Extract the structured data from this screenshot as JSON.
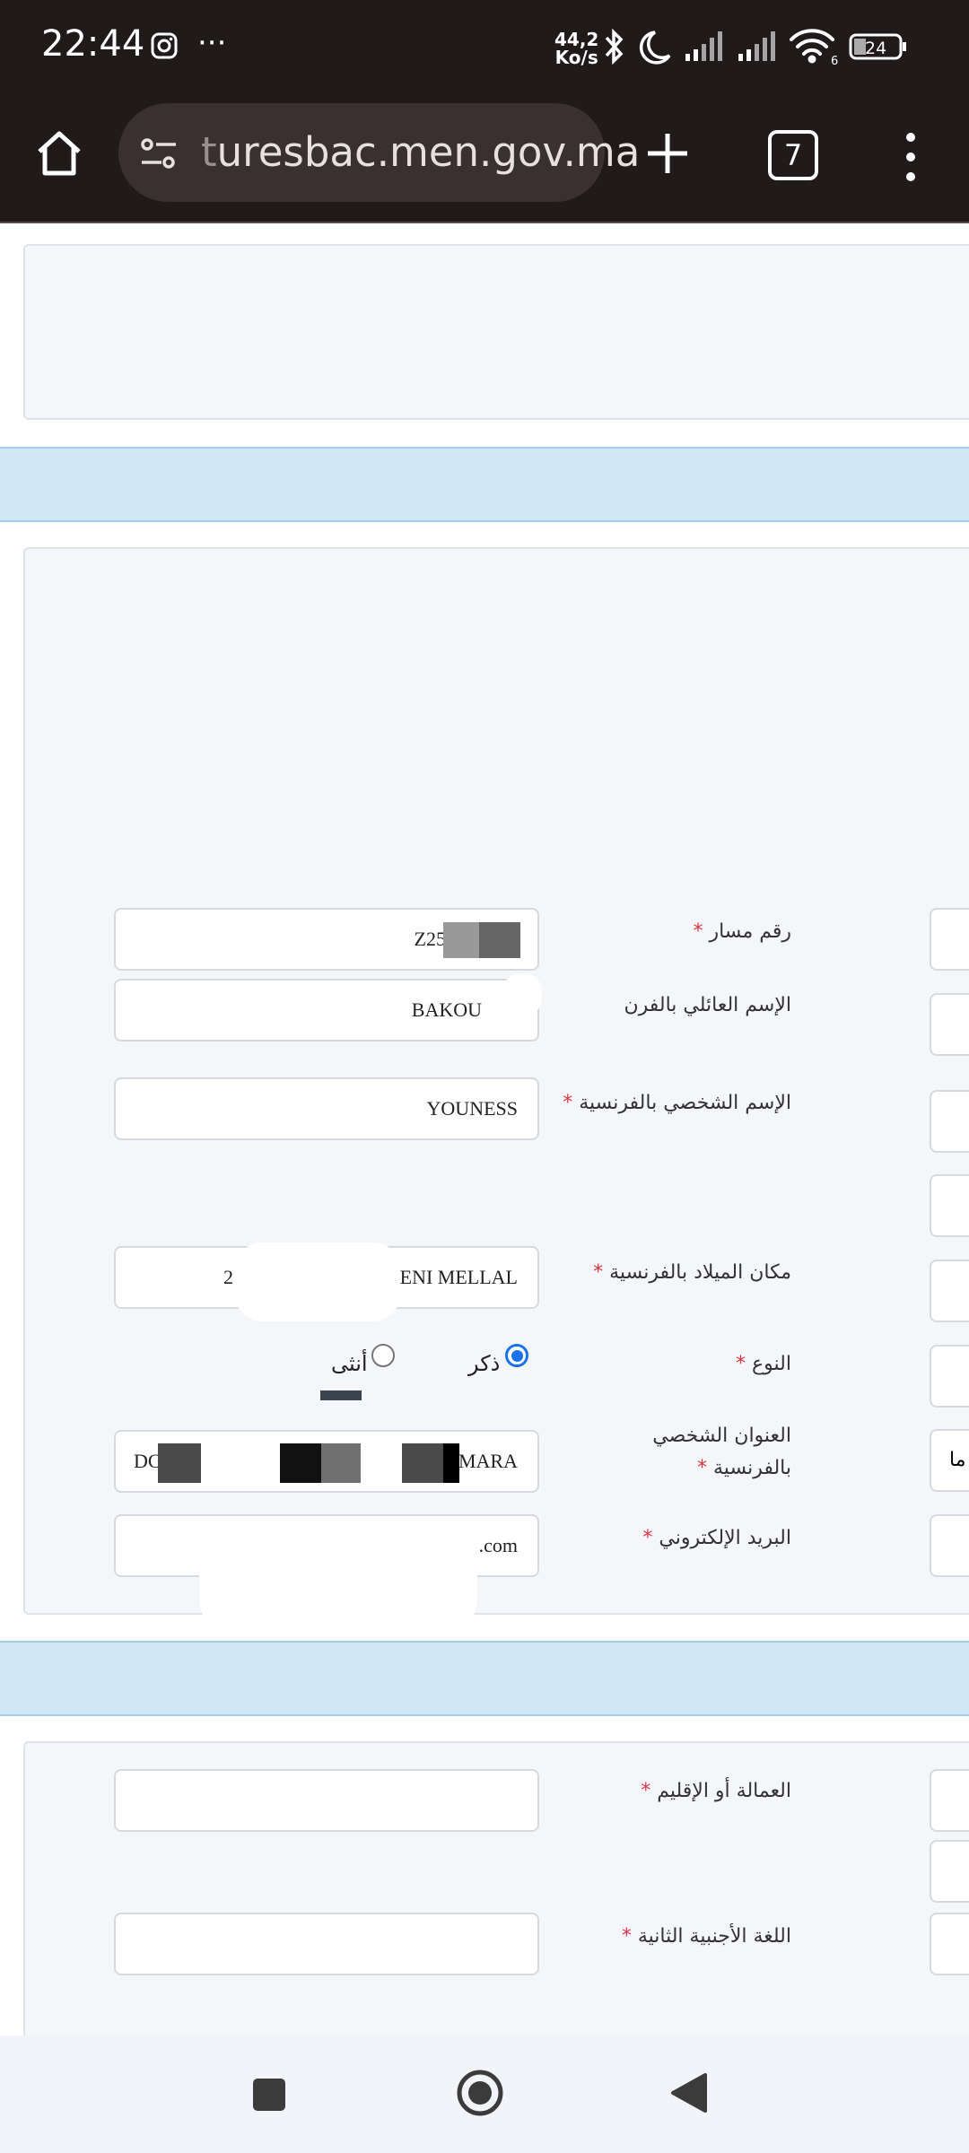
{
  "status_bar": {
    "time": "22:44",
    "more": "···",
    "net_speed_value": "44,2",
    "net_speed_unit": "Ko/s",
    "wifi_badge": "6",
    "battery": "24"
  },
  "browser": {
    "url_dim": "t",
    "url": "uresbac.men.gov.ma",
    "tab_count": "7"
  },
  "form": {
    "fields": [
      {
        "label": "رقم مسار",
        "required": true,
        "value": "Z25"
      },
      {
        "label": "الإسم العائلي بالفرن",
        "required": false,
        "value": "BAKOU"
      },
      {
        "label": "الإسم الشخصي بالفرنسية",
        "required": true,
        "value": "YOUNESS"
      },
      {
        "label": "مكان الميلاد بالفرنسية",
        "required": true,
        "value": "BENI MELLAL",
        "prefix": "2"
      },
      {
        "label": "النوع",
        "required": true
      },
      {
        "label_line1": "العنوان الشخصي",
        "label_line2": "بالفرنسية",
        "required": true,
        "value": "EMARA",
        "prefix": "DC"
      },
      {
        "label": "البريد الإلكتروني",
        "required": true,
        "value": ".com"
      }
    ],
    "gender": {
      "male": "ذكر",
      "female": "أنثى",
      "selected": "male"
    },
    "side_value": "ما",
    "asterisk": "*"
  },
  "form2": {
    "fields": [
      {
        "label": "العمالة أو الإقليم",
        "required": true,
        "value": ""
      },
      {
        "label": "اللغة الأجنبية الثانية",
        "required": true,
        "value": ""
      }
    ]
  },
  "colors": {
    "band": "#cfe7f5",
    "required": "#dc3545",
    "radio_selected": "#1a73e8"
  }
}
